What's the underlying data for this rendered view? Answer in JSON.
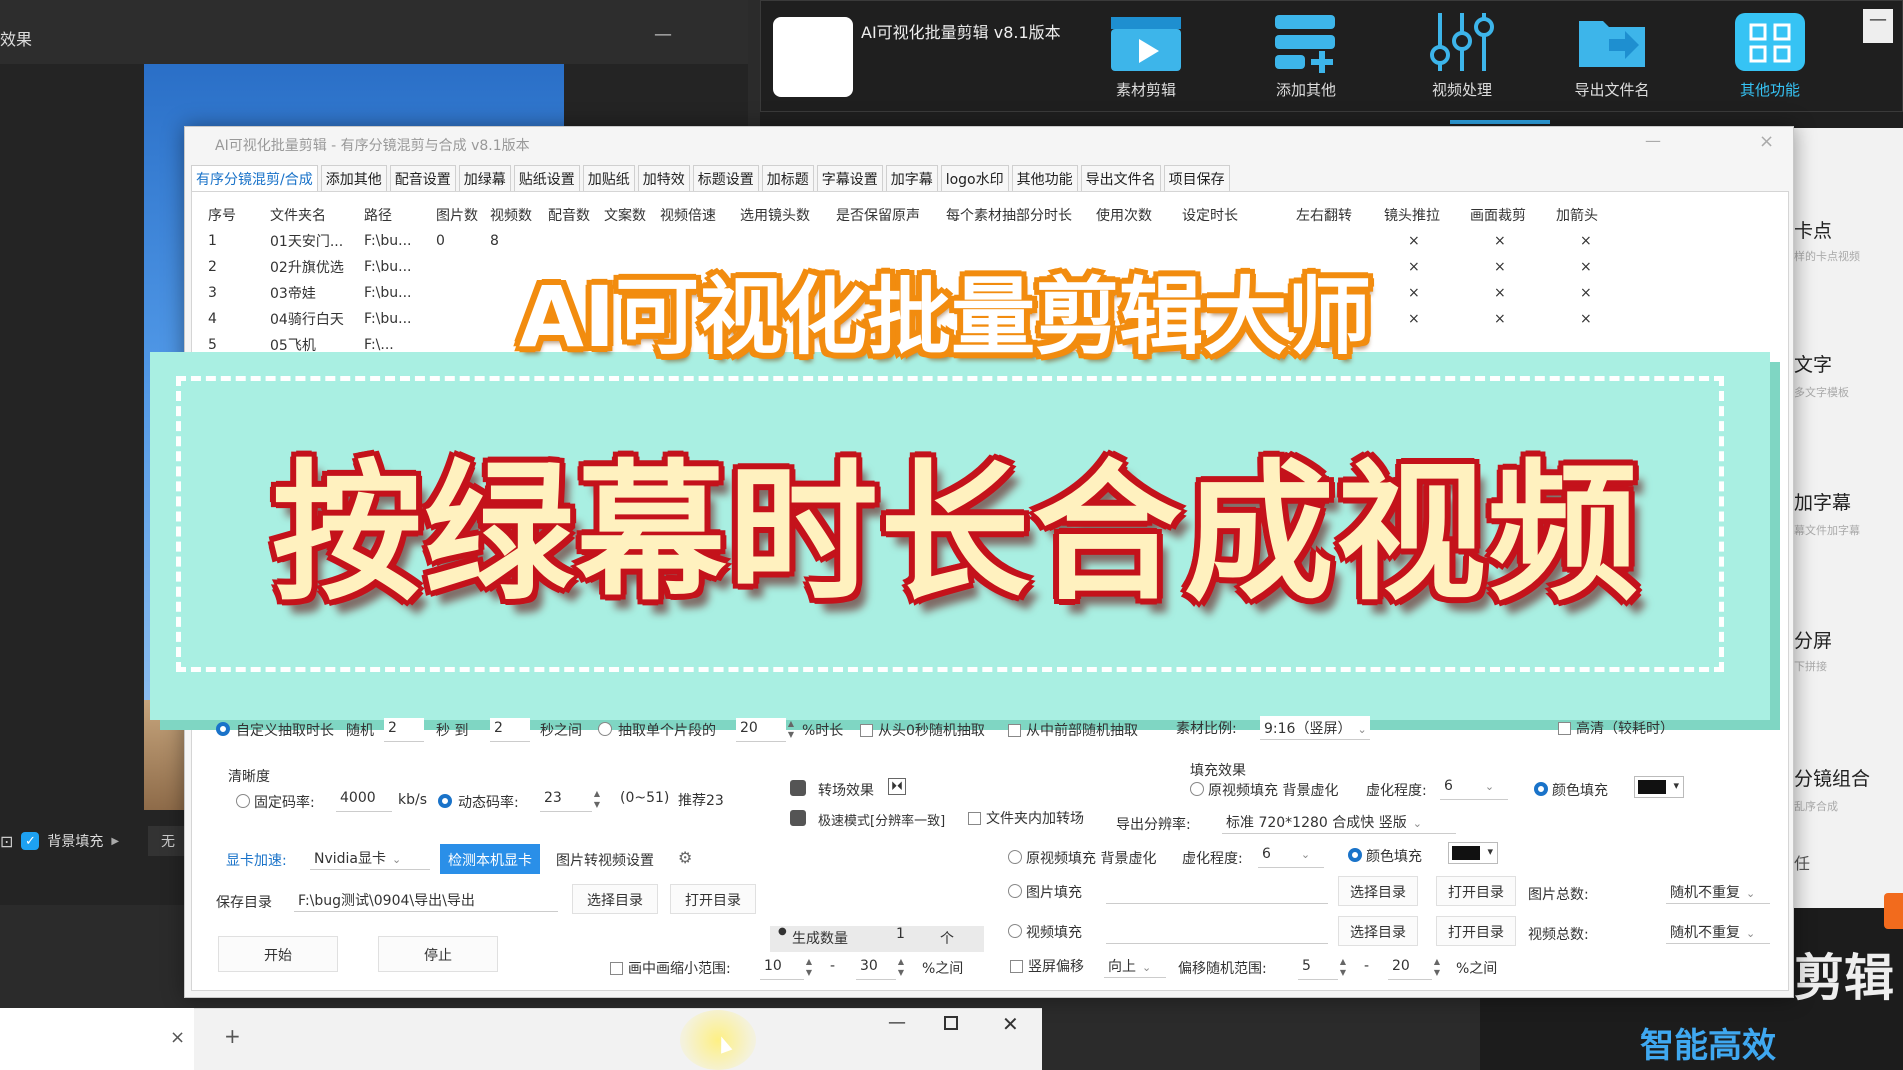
{
  "left_window": {
    "title": "效果",
    "min_icon": "minimize-icon",
    "bg_fill_label": "背景填充",
    "bg_fill_value": "无"
  },
  "right_app": {
    "title": "AI可视化批量剪辑 v8.1版本",
    "nav": [
      {
        "label": "素材剪辑",
        "icon": "clapper-icon"
      },
      {
        "label": "添加其他",
        "icon": "add-list-icon"
      },
      {
        "label": "视频处理",
        "icon": "sliders-icon"
      },
      {
        "label": "导出文件名",
        "icon": "export-folder-icon"
      },
      {
        "label": "其他功能",
        "icon": "grid-icon"
      }
    ],
    "min_label": "—"
  },
  "side": {
    "items": [
      {
        "label": "卡点",
        "sub": "样的卡点视频"
      },
      {
        "label": "文字",
        "sub": "多文字模板"
      },
      {
        "label": "加字幕",
        "sub": "幕文件加字幕"
      },
      {
        "label": "分屏",
        "sub": "下拼接"
      },
      {
        "label": "分镜组合",
        "sub": "乱序合成"
      }
    ],
    "ren": "任",
    "jianji": "剪辑",
    "slogan": "智能高效"
  },
  "dialog": {
    "title": "AI可视化批量剪辑 - 有序分镜混剪与合成  v8.1版本",
    "min_label": "—",
    "close_label": "×",
    "tabs": [
      "有序分镜混剪/合成",
      "添加其他",
      "配音设置",
      "加绿幕",
      "贴纸设置",
      "加贴纸",
      "加特效",
      "标题设置",
      "加标题",
      "字幕设置",
      "加字幕",
      "logo水印",
      "其他功能",
      "导出文件名",
      "项目保存"
    ],
    "table": {
      "headers": [
        "序号",
        "文件夹名",
        "路径",
        "图片数",
        "视频数",
        "配音数",
        "文案数",
        "视频倍速",
        "选用镜头数",
        "是否保留原声",
        "每个素材抽部分时长",
        "使用次数",
        "设定时长",
        "左右翻转",
        "镜头推拉",
        "画面裁剪",
        "加箭头"
      ],
      "rows": [
        [
          "1",
          "01天安门...",
          "F:\\bu...",
          "0",
          "8",
          "",
          "",
          "",
          "",
          "",
          "",
          "",
          "",
          "",
          "×",
          "×",
          "×"
        ],
        [
          "2",
          "02升旗优选",
          "F:\\bu...",
          "",
          "",
          "",
          "",
          "",
          "",
          "",
          "",
          "",
          "",
          "",
          "×",
          "×",
          "×"
        ],
        [
          "3",
          "03帝娃",
          "F:\\bu...",
          "",
          "",
          "",
          "",
          "",
          "",
          "",
          "",
          "",
          "",
          "",
          "×",
          "×",
          "×"
        ],
        [
          "4",
          "04骑行白天",
          "F:\\bu...",
          "",
          "",
          "",
          "",
          "",
          "",
          "",
          "",
          "",
          "",
          "",
          "×",
          "×",
          "×"
        ],
        [
          "5",
          "05飞机",
          "F:\\...",
          "",
          "",
          "",
          "",
          "",
          "",
          "",
          "",
          "",
          "",
          "",
          "",
          "",
          ""
        ]
      ]
    }
  },
  "overlay": {
    "top": "AI可视化批量剪辑大师",
    "main": "按绿幕时长合成视频"
  },
  "form": {
    "custom_len": "自定义抽取时长",
    "random": "随机",
    "sec_from": "2",
    "sec_to_label": "秒 到",
    "sec_to": "2",
    "sec_between": "秒之间",
    "single_pct": "抽取单个片段的",
    "pct_val": "20",
    "pct_long": "%时长",
    "from_zero": "从头0秒随机抽取",
    "from_mid": "从中前部随机抽取",
    "ratio_label": "素材比例:",
    "ratio_val": "9:16（竖屏）",
    "hd": "高清（较耗时）",
    "clarity": "清晰度",
    "fixed_rate": "固定码率:",
    "fixed_val": "4000",
    "kbs": "kb/s",
    "dyn_rate": "动态码率:",
    "dyn_val": "23",
    "dyn_range": "(0~51)",
    "recommend": "推荐23",
    "transition": "转场效果",
    "fast_mode": "极速模式[分辨率一致]",
    "folder_trans": "文件夹内加转场",
    "fill_effect": "填充效果",
    "orig_fill_1": "原视频填充 背景虚化",
    "blur_label_1": "虚化程度:",
    "blur_val_1": "6",
    "color_fill_1": "颜色填充",
    "export_res_label": "导出分辨率:",
    "export_res": "标准 720*1280 合成快 竖版",
    "gpu_label": "显卡加速:",
    "gpu_val": "Nvidia显卡",
    "detect_gpu": "检测本机显卡",
    "img2video": "图片转视频设置",
    "gear": "gear-icon",
    "orig_fill_2": "原视频填充 背景虚化",
    "blur_label_2": "虚化程度:",
    "blur_val_2": "6",
    "color_fill_2": "颜色填充",
    "save_dir_label": "保存目录",
    "save_dir": "F:\\bug测试\\0904\\导出\\导出",
    "choose_dir": "选择目录",
    "open_dir": "打开目录",
    "img_fill": "图片填充",
    "img_choose": "选择目录",
    "img_open": "打开目录",
    "img_total": "图片总数:",
    "img_total_val": "随机不重复",
    "video_fill": "视频填充",
    "vid_choose": "选择目录",
    "vid_open": "打开目录",
    "video_total": "视频总数:",
    "video_total_val": "随机不重复",
    "start": "开始",
    "stop": "停止",
    "gen_count": "生成数量",
    "gen_val": "1",
    "unit": "个",
    "pip_shrink": "画中画缩小范围:",
    "pip_from": "10",
    "pip_to": "30",
    "pip_pct": "%之间",
    "dash": "-",
    "vert_offset": "竖屏偏移",
    "dir_val": "向上",
    "offset_range": "偏移随机范围:",
    "off_from": "5",
    "off_to": "20",
    "off_pct": "%之间"
  },
  "taskbar": {
    "close": "×",
    "plus": "+",
    "min": "—",
    "x": "✕"
  },
  "colors": {
    "accent_blue": "#2a8fe8",
    "overlay_mint": "#a9efe2",
    "title_red": "#c4121b",
    "title_orange": "#f28c0f"
  }
}
